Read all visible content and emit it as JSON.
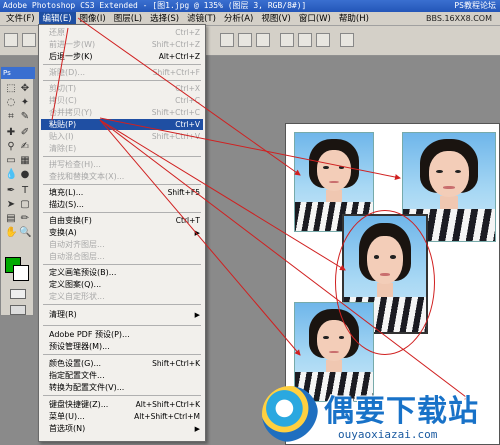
{
  "window": {
    "title": "Adobe Photoshop CS3 Extended - [图1.jpg @ 135% (图层 3, RGB/8#)]",
    "watermark_top": "PS教程论坛",
    "watermark_url": "BBS.16XX8.COM"
  },
  "menubar": {
    "items": [
      "文件(F)",
      "编辑(E)",
      "图像(I)",
      "图层(L)",
      "选择(S)",
      "滤镜(T)",
      "分析(A)",
      "视图(V)",
      "窗口(W)",
      "帮助(H)"
    ]
  },
  "toolbox": {
    "label": "Ps"
  },
  "edit_menu": {
    "items": [
      {
        "label": "还原",
        "shortcut": "Ctrl+Z",
        "disabled": true
      },
      {
        "label": "前进一步(W)",
        "shortcut": "Shift+Ctrl+Z",
        "disabled": true
      },
      {
        "label": "后退一步(K)",
        "shortcut": "Alt+Ctrl+Z",
        "disabled": false
      },
      {
        "label": "渐隐(D)...",
        "shortcut": "Shift+Ctrl+F",
        "disabled": true
      },
      {
        "label": "剪切(T)",
        "shortcut": "Ctrl+X",
        "disabled": true
      },
      {
        "label": "拷贝(C)",
        "shortcut": "Ctrl+C",
        "disabled": true
      },
      {
        "label": "合并拷贝(Y)",
        "shortcut": "Shift+Ctrl+C",
        "disabled": true
      },
      {
        "label": "粘贴(P)",
        "shortcut": "Ctrl+V",
        "disabled": false,
        "highlighted": true
      },
      {
        "label": "贴入(I)",
        "shortcut": "Shift+Ctrl+V",
        "disabled": true
      },
      {
        "label": "清除(E)",
        "shortcut": "",
        "disabled": true
      },
      {
        "label": "拼写检查(H)...",
        "shortcut": "",
        "disabled": true
      },
      {
        "label": "查找和替换文本(X)...",
        "shortcut": "",
        "disabled": true
      },
      {
        "label": "填充(L)...",
        "shortcut": "Shift+F5",
        "disabled": false
      },
      {
        "label": "描边(S)...",
        "shortcut": "",
        "disabled": false
      },
      {
        "label": "自由变换(F)",
        "shortcut": "Ctrl+T",
        "disabled": false
      },
      {
        "label": "变换(A)",
        "shortcut": "",
        "disabled": false,
        "submenu": true
      },
      {
        "label": "自动对齐图层...",
        "shortcut": "",
        "disabled": true
      },
      {
        "label": "自动混合图层...",
        "shortcut": "",
        "disabled": true
      },
      {
        "label": "定义画笔预设(B)...",
        "shortcut": "",
        "disabled": false
      },
      {
        "label": "定义图案(Q)...",
        "shortcut": "",
        "disabled": false
      },
      {
        "label": "定义自定形状...",
        "shortcut": "",
        "disabled": true
      },
      {
        "label": "清理(R)",
        "shortcut": "",
        "disabled": false,
        "submenu": true
      },
      {
        "label": "Adobe PDF 预设(P)...",
        "shortcut": "",
        "disabled": false
      },
      {
        "label": "预设管理器(M)...",
        "shortcut": "",
        "disabled": false
      },
      {
        "label": "颜色设置(G)...",
        "shortcut": "Shift+Ctrl+K",
        "disabled": false
      },
      {
        "label": "指定配置文件...",
        "shortcut": "",
        "disabled": false
      },
      {
        "label": "转换为配置文件(V)...",
        "shortcut": "",
        "disabled": false
      },
      {
        "label": "键盘快捷键(Z)...",
        "shortcut": "Alt+Shift+Ctrl+K",
        "disabled": false
      },
      {
        "label": "菜单(U)...",
        "shortcut": "Alt+Shift+Ctrl+M",
        "disabled": false
      },
      {
        "label": "首选项(N)",
        "shortcut": "",
        "disabled": false,
        "submenu": true
      }
    ]
  },
  "logo": {
    "name": "偶要下载站",
    "url": "ouyaoxiazai.com"
  },
  "colors": {
    "accent": "#1f4fa3",
    "foreground_swatch": "#00aa00",
    "annotation_red": "#d02020"
  }
}
